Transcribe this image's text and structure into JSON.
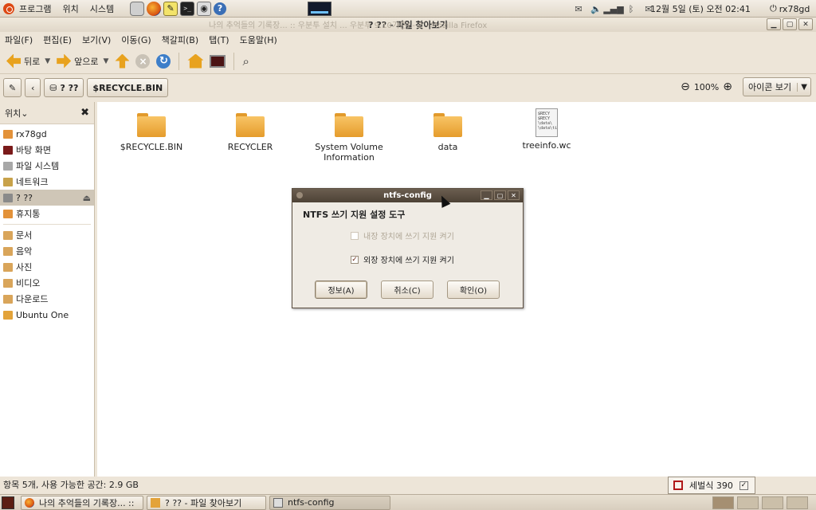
{
  "top_panel": {
    "menus": [
      "프로그램",
      "위치",
      "시스템"
    ],
    "launchers": [
      "help-icon",
      "firefox-icon",
      "text-editor-icon",
      "terminal-icon",
      "screenshot-icon",
      "help-icon"
    ],
    "ghost_title": "나의 추억들의 기록장... :: 우분투 설치 ... 우분투 9.10기준) - 2 - Mozilla Firefox",
    "clock": "12월  5일 (토) 오전 02:41",
    "user": "rx78gd"
  },
  "window": {
    "title": "? ?? - 파일 찾아보기",
    "controls": [
      "minimize",
      "maximize",
      "close"
    ]
  },
  "menubar": [
    "파일(F)",
    "편집(E)",
    "보기(V)",
    "이동(G)",
    "책갈피(B)",
    "탭(T)",
    "도움말(H)"
  ],
  "toolbar": {
    "back_label": "뒤로",
    "forward_label": "앞으로"
  },
  "location": {
    "path_current": "? ??",
    "path_next": "$RECYCLE.BIN",
    "zoom": "100%",
    "view_mode": "아이콘 보기"
  },
  "sidebar": {
    "header": "위치",
    "items": [
      {
        "label": "rx78gd",
        "icon": "home-folder-icon",
        "color": "#e3923a"
      },
      {
        "label": "바탕 화면",
        "icon": "desktop-icon",
        "color": "#7a1a1a"
      },
      {
        "label": "파일 시스템",
        "icon": "hard-drive-icon",
        "color": "#a8a8a8"
      },
      {
        "label": "네트워크",
        "icon": "network-icon",
        "color": "#c8a24a"
      },
      {
        "label": "? ??",
        "icon": "drive-icon",
        "color": "#8a8a8a",
        "selected": true
      },
      {
        "label": "휴지통",
        "icon": "trash-icon",
        "color": "#e3923a"
      },
      {
        "label": "문서",
        "icon": "documents-folder-icon",
        "color": "#d9a55a"
      },
      {
        "label": "음악",
        "icon": "music-folder-icon",
        "color": "#d9a55a"
      },
      {
        "label": "사진",
        "icon": "pictures-folder-icon",
        "color": "#d9a55a"
      },
      {
        "label": "비디오",
        "icon": "videos-folder-icon",
        "color": "#d9a55a"
      },
      {
        "label": "다운로드",
        "icon": "downloads-folder-icon",
        "color": "#d9a55a"
      },
      {
        "label": "Ubuntu One",
        "icon": "folder-icon",
        "color": "#e3a33a"
      }
    ]
  },
  "files": [
    {
      "name": "$RECYCLE.BIN",
      "type": "folder"
    },
    {
      "name": "RECYCLER",
      "type": "folder"
    },
    {
      "name": "System Volume Information",
      "type": "folder"
    },
    {
      "name": "data",
      "type": "folder"
    },
    {
      "name": "treeinfo.wc",
      "type": "text",
      "preview": "$RECY\n$RECY\n\\data\\\n\\data\\ti"
    }
  ],
  "dialog": {
    "title": "ntfs-config",
    "heading": "NTFS 쓰기 지원 설정 도구",
    "check_internal": "내장 장치에 쓰기 지원 켜기",
    "check_external": "외장 장치에 쓰기 지원 켜기",
    "btn_about": "정보(A)",
    "btn_cancel": "취소(C)",
    "btn_ok": "확인(O)"
  },
  "statusbar": "항목 5개, 사용 가능한 공간: 2.9 GB",
  "ime": {
    "label": "세벌식 390"
  },
  "taskbar": [
    {
      "label": "나의 추억들의 기록장... ::",
      "icon": "firefox-icon"
    },
    {
      "label": "? ?? - 파일 찾아보기",
      "icon": "folder-icon"
    },
    {
      "label": "ntfs-config",
      "icon": "window-icon",
      "active": true
    }
  ]
}
